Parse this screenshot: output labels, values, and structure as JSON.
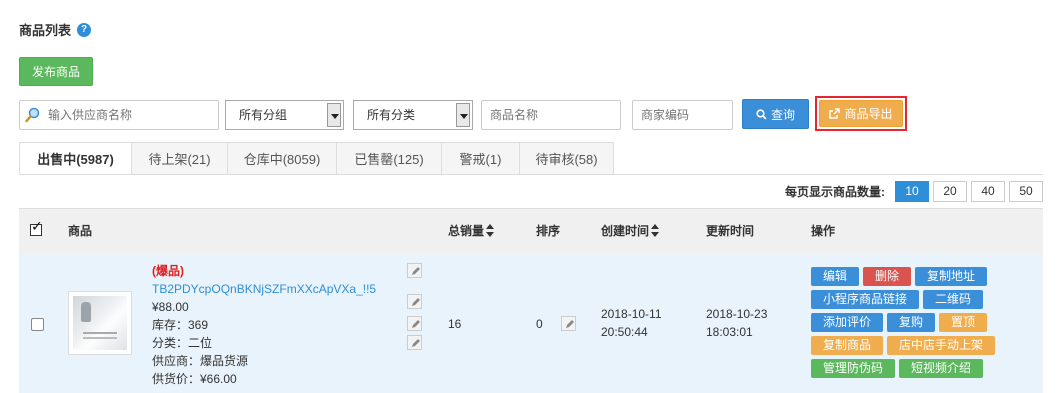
{
  "page": {
    "title": "商品列表",
    "help_icon": "help-circle-icon"
  },
  "actions": {
    "publish_label": "发布商品",
    "query_label": "查询",
    "export_label": "商品导出"
  },
  "filters": {
    "supplier_placeholder": "输入供应商名称",
    "group_selected": "所有分组",
    "category_selected": "所有分类",
    "name_placeholder": "商品名称",
    "code_placeholder": "商家编码"
  },
  "tabs": [
    {
      "label": "出售中(5987)",
      "active": true
    },
    {
      "label": "待上架(21)"
    },
    {
      "label": "仓库中(8059)"
    },
    {
      "label": "已售罄(125)"
    },
    {
      "label": "警戒(1)"
    },
    {
      "label": "待审核(58)"
    }
  ],
  "per_page": {
    "label": "每页显示商品数量:",
    "options": [
      "10",
      "20",
      "40",
      "50"
    ],
    "selected": "10"
  },
  "table": {
    "headers": {
      "product": "商品",
      "sales": "总销量",
      "sort": "排序",
      "created": "创建时间",
      "updated": "更新时间",
      "ops": "操作"
    },
    "rows": [
      {
        "tag": "(爆品)",
        "title": "TB2PDYcpOQnBKNjSZFmXXcApVXa_!!5",
        "price": "¥88.00",
        "stock": "库存：369",
        "category": "分类：二位",
        "supplier": "供应商：爆品货源",
        "supply_price": "供货价：¥66.00",
        "sales": "16",
        "sort": "0",
        "created_date": "2018-10-11",
        "created_time": "20:50:44",
        "updated_date": "2018-10-23",
        "updated_time": "18:03:01",
        "ops": {
          "edit": "编辑",
          "delete": "删除",
          "copy_url": "复制地址",
          "mini_link": "小程序商品链接",
          "qrcode": "二维码",
          "add_review": "添加评价",
          "rebuy": "复购",
          "top": "置顶",
          "copy_product": "复制商品",
          "shop_listing": "店中店手动上架",
          "anti_fake": "管理防伪码",
          "video_intro": "短视频介绍"
        }
      }
    ]
  },
  "colors": {
    "primary": "#3a8fd8",
    "success": "#5cb85c",
    "warning": "#f0ad4e",
    "danger": "#d9534f",
    "highlight": "#e8262f"
  }
}
